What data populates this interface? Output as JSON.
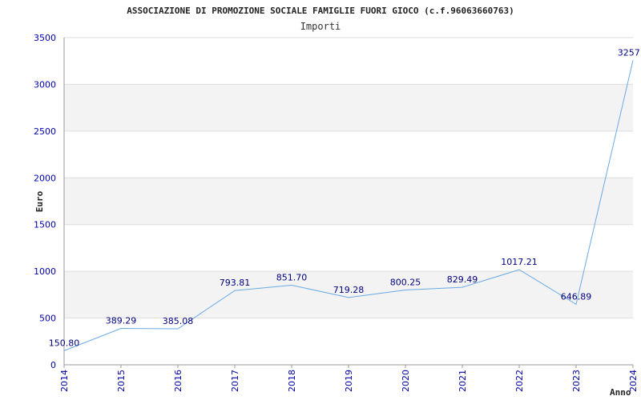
{
  "chart_data": {
    "type": "line",
    "title": "ASSOCIAZIONE DI PROMOZIONE SOCIALE FAMIGLIE FUORI GIOCO (c.f.96063660763)",
    "subtitle": "Importi",
    "xlabel": "Anno",
    "ylabel": "Euro",
    "categories": [
      "2014",
      "2015",
      "2016",
      "2017",
      "2018",
      "2019",
      "2020",
      "2021",
      "2022",
      "2023",
      "2024"
    ],
    "values": [
      150.8,
      389.29,
      385.08,
      793.81,
      851.7,
      719.28,
      800.25,
      829.49,
      1017.21,
      646.89,
      3257.0
    ],
    "value_labels": [
      "150.80",
      "389.29",
      "385.08",
      "793.81",
      "851.70",
      "719.28",
      "800.25",
      "829.49",
      "1017.21",
      "646.89",
      "3257.0"
    ],
    "ylim": [
      0,
      3500
    ],
    "yticks": [
      "0",
      "500",
      "1000",
      "1500",
      "2000",
      "2500",
      "3000",
      "3500"
    ],
    "grid": true,
    "colors": {
      "line": "#6aaae4",
      "band": "#f3f3f3",
      "tick_text": "#0000aa",
      "label_text": "#000080"
    }
  }
}
